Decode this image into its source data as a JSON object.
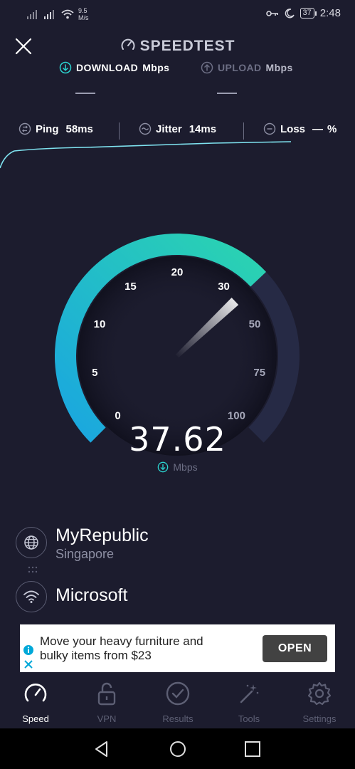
{
  "status_bar": {
    "net_speed": "9.5",
    "net_speed_unit": "M/s",
    "battery": "37",
    "time": "2:48"
  },
  "header": {
    "title": "SPEEDTEST",
    "close_icon": "close-icon"
  },
  "tabs": {
    "download_label": "DOWNLOAD",
    "download_unit": "Mbps",
    "upload_label": "UPLOAD",
    "upload_unit": "Mbps",
    "download_value": "—",
    "upload_value": "—"
  },
  "metrics": {
    "ping_label": "Ping",
    "ping_value": "58ms",
    "jitter_label": "Jitter",
    "jitter_value": "14ms",
    "loss_label": "Loss",
    "loss_value": "—",
    "loss_unit": "%"
  },
  "gauge": {
    "scale": [
      "0",
      "5",
      "10",
      "15",
      "20",
      "30",
      "50",
      "75",
      "100"
    ],
    "current_value": 37.62,
    "value_text": "37.62",
    "unit": "Mbps",
    "accent_start": "#1aa6e0",
    "accent_end": "#2bd4b0"
  },
  "servers": {
    "isp_name": "MyRepublic",
    "isp_location": "Singapore",
    "host_name": "Microsoft"
  },
  "ad": {
    "text_line1": "Move your heavy furniture and",
    "text_line2": "bulky items from $23",
    "button": "OPEN"
  },
  "nav": {
    "items": [
      {
        "label": "Speed",
        "icon": "speedometer-icon",
        "active": true
      },
      {
        "label": "VPN",
        "icon": "lock-icon",
        "active": false
      },
      {
        "label": "Results",
        "icon": "check-circle-icon",
        "active": false
      },
      {
        "label": "Tools",
        "icon": "magic-wand-icon",
        "active": false
      },
      {
        "label": "Settings",
        "icon": "gear-icon",
        "active": false
      }
    ]
  },
  "colors": {
    "background": "#1c1c2e",
    "accent": "#2bd4b0",
    "muted": "#6c6e84"
  }
}
